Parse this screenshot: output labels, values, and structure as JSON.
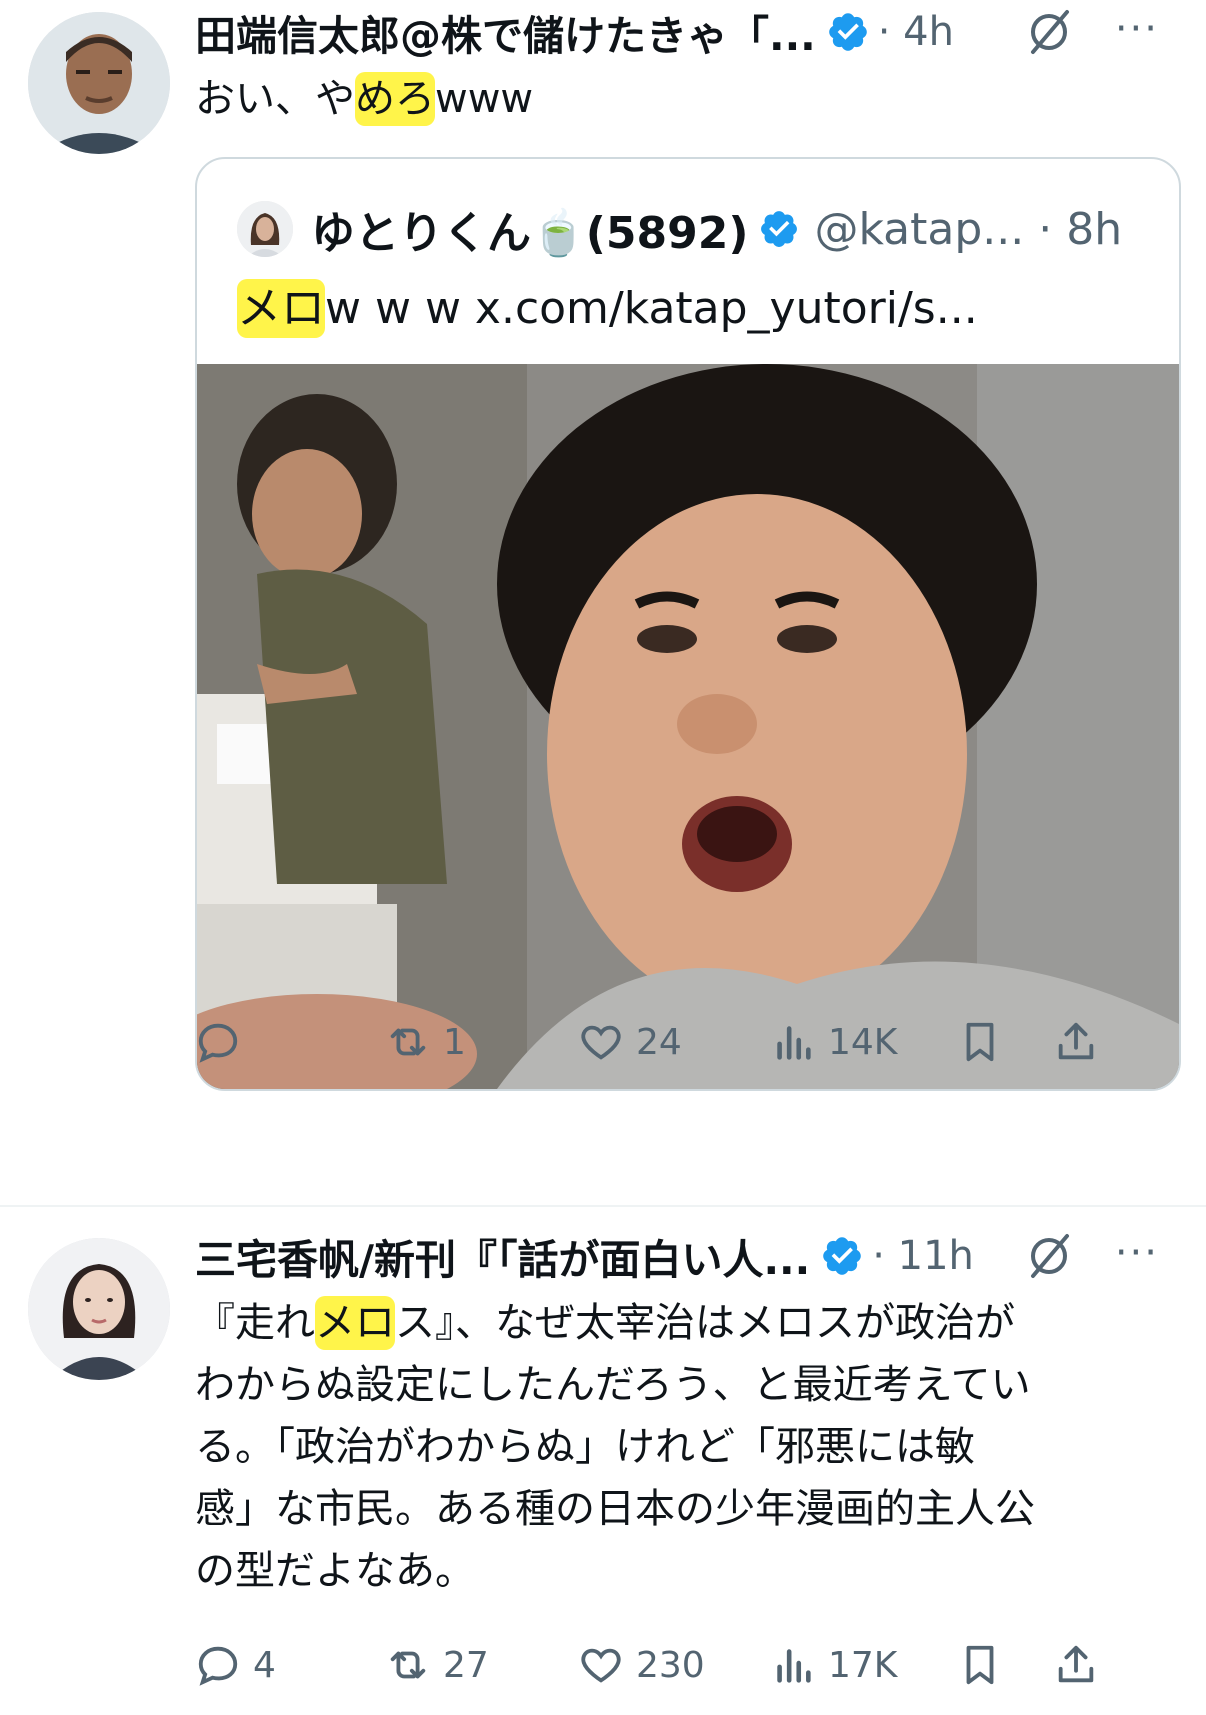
{
  "tweets": [
    {
      "author": "田端信太郎@株で儲けたきゃ「...",
      "time": "· 4h",
      "more": "···",
      "text_parts": [
        "おい、や",
        "めろ",
        "www"
      ],
      "quote": {
        "author": "ゆとりくん🍵(5892)",
        "handle": "@katap... · 8h",
        "text_parts": [
          "メロ",
          "w w w  x.com/katap_yutori/s..."
        ]
      },
      "stats": {
        "replies": "",
        "retweets": "1",
        "likes": "24",
        "views": "14K"
      }
    },
    {
      "author": "三宅香帆/新刊『「話が面白い人...",
      "time": "· 11h",
      "more": "···",
      "text_parts": [
        "『走れ",
        "メロ",
        "ス』、なぜ太宰治はメロスが政治が\nわからぬ設定にしたんだろう、と最近考えてい\nる。「政治がわからぬ」けれど「邪悪には敏\n感」な市民。ある種の日本の少年漫画的主人公\nの型だよなあ。"
      ],
      "stats": {
        "replies": "4",
        "retweets": "27",
        "likes": "230",
        "views": "17K"
      }
    }
  ],
  "colors": {
    "accent": "#1d9bf0",
    "muted": "#536471",
    "highlight": "#fff44a"
  },
  "icons": [
    "verified-badge-icon",
    "grok-icon",
    "more-icon",
    "reply-icon",
    "retweet-icon",
    "like-icon",
    "views-icon",
    "bookmark-icon",
    "share-icon"
  ]
}
